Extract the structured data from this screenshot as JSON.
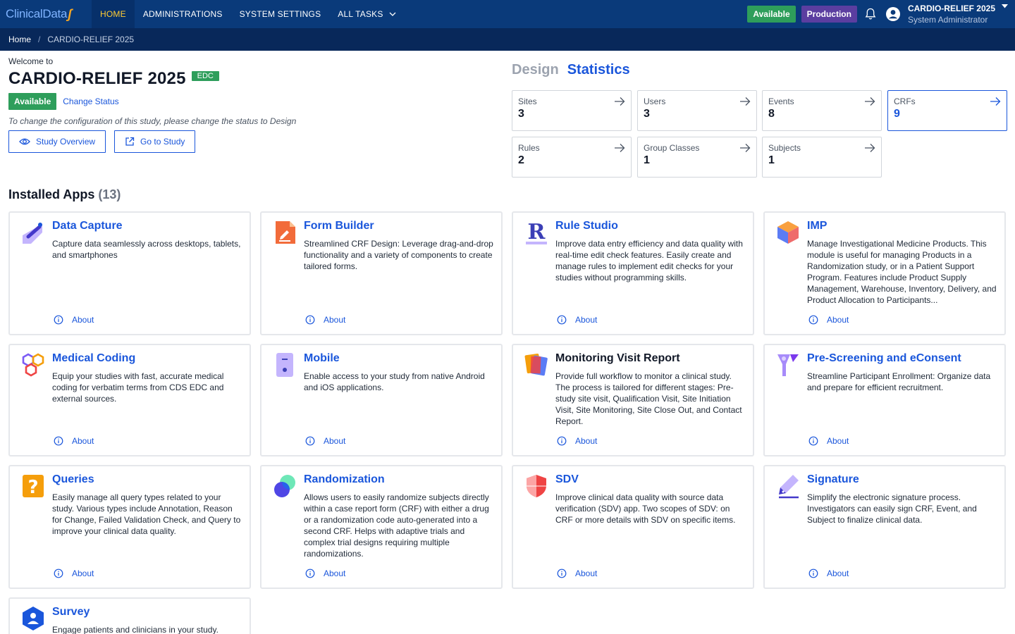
{
  "nav": {
    "logo_text": "ClinicalData",
    "logo_mark": "ʃ",
    "items": [
      {
        "label": "HOME",
        "active": true
      },
      {
        "label": "ADMINISTRATIONS"
      },
      {
        "label": "SYSTEM SETTINGS"
      },
      {
        "label": "ALL TASKS",
        "chevron": "chevron-down-icon"
      }
    ],
    "env_status": "Available",
    "env_name": "Production",
    "user_name": "CARDIO-RELIEF 2025",
    "user_role": "System Administrator",
    "colors": {
      "nav_bg": "#0a3a7a",
      "active_text": "#ffcc33",
      "green": "#2e9e5b",
      "purple": "#5b3ea0"
    }
  },
  "breadcrumb": {
    "home": "Home",
    "sep": "/",
    "current": "CARDIO-RELIEF 2025"
  },
  "welcome": {
    "label": "Welcome to",
    "study_title": "CARDIO-RELIEF 2025",
    "badge": "EDC",
    "status": "Available",
    "change_status": "Change Status",
    "hint": "To change the configuration of this study, please change the status to Design",
    "overview_btn": "Study Overview",
    "go_btn": "Go to Study"
  },
  "stats": {
    "tabs": [
      "Design",
      "Statistics"
    ],
    "active_tab": "Statistics",
    "cards": [
      {
        "label": "Sites",
        "value": "3"
      },
      {
        "label": "Users",
        "value": "3"
      },
      {
        "label": "Events",
        "value": "8"
      },
      {
        "label": "CRFs",
        "value": "9",
        "selected": true
      },
      {
        "label": "Rules",
        "value": "2"
      },
      {
        "label": "Group Classes",
        "value": "1"
      },
      {
        "label": "Subjects",
        "value": "1"
      }
    ]
  },
  "apps": {
    "heading": "Installed Apps",
    "count": "(13)",
    "about_label": "About",
    "items": [
      {
        "title": "Data Capture",
        "icon": "data-capture-icon",
        "desc": "Capture data seamlessly across desktops, tablets, and smartphones"
      },
      {
        "title": "Form Builder",
        "icon": "form-builder-icon",
        "desc": "Streamlined CRF Design: Leverage drag-and-drop functionality and a variety of components to create tailored forms."
      },
      {
        "title": "Rule Studio",
        "icon": "rule-studio-icon",
        "desc": "Improve data entry efficiency and data quality with real-time edit check features. Easily create and manage rules to implement edit checks for your studies without programming skills."
      },
      {
        "title": "IMP",
        "icon": "imp-cube-icon",
        "desc": "Manage Investigational Medicine Products. This module is useful for managing Products in a Randomization study, or in a Patient Support Program. Features include Product Supply Management, Warehouse, Inventory, Delivery, and Product Allocation to Participants..."
      },
      {
        "title": "Medical Coding",
        "icon": "medical-coding-icon",
        "desc": "Equip your studies with fast, accurate medical coding for verbatim terms from CDS EDC and external sources."
      },
      {
        "title": "Mobile",
        "icon": "mobile-icon",
        "desc": "Enable access to your study from native Android and iOS applications."
      },
      {
        "title": "Monitoring Visit Report",
        "icon": "monitoring-report-icon",
        "desc": "Provide full workflow to monitor a clinical study. The process is tailored for different stages: Pre-study site visit, Qualification Visit, Site Initiation Visit, Site Monitoring, Site Close Out, and Contact Report."
      },
      {
        "title": "Pre-Screening and eConsent",
        "icon": "pre-screening-icon",
        "desc": "Streamline Participant Enrollment: Organize data and prepare for efficient recruitment."
      },
      {
        "title": "Queries",
        "icon": "queries-icon",
        "desc": "Easily manage all query types related to your study. Various types include Annotation, Reason for Change, Failed Validation Check, and Query to improve your clinical data quality."
      },
      {
        "title": "Randomization",
        "icon": "randomization-icon",
        "desc": "Allows users to easily randomize subjects directly within a case report form (CRF) with either a drug or a randomization code auto-generated into a second CRF. Helps with adaptive trials and complex trial designs requiring multiple randomizations."
      },
      {
        "title": "SDV",
        "icon": "sdv-shield-icon",
        "desc": "Improve clinical data quality with source data verification (SDV) app. Two scopes of SDV: on CRF or more details with SDV on specific items."
      },
      {
        "title": "Signature",
        "icon": "signature-pen-icon",
        "desc": "Simplify the electronic signature process. Investigators can easily sign CRF, Event, and Subject to finalize clinical data."
      },
      {
        "title": "Survey",
        "icon": "survey-icon",
        "desc": "Engage patients and clinicians in your study."
      }
    ]
  }
}
